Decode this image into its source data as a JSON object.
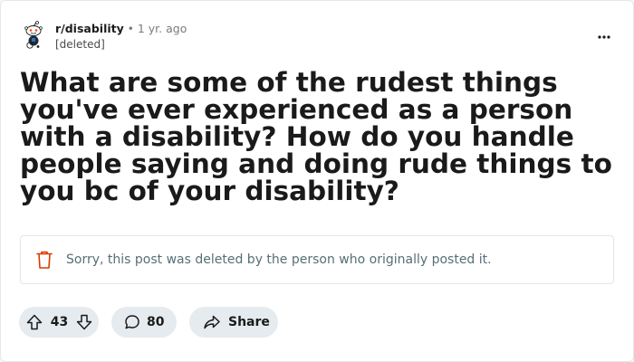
{
  "post": {
    "subreddit": "r/disability",
    "separator": "•",
    "time": "1 yr. ago",
    "author": "[deleted]",
    "title": "What are some of the rudest things you've ever experienced as a person with a disability? How do you handle people saying and doing rude things to you bc of your disability?",
    "deleted_notice": "Sorry, this post was deleted by the person who originally posted it."
  },
  "actions": {
    "vote_count": "43",
    "comment_count": "80",
    "share_label": "Share"
  },
  "icons": {
    "avatar": "reddit-snoo-avatar-icon",
    "more": "more-options-icon",
    "trash": "trash-icon",
    "upvote": "upvote-arrow-icon",
    "downvote": "downvote-arrow-icon",
    "comment": "comment-bubble-icon",
    "share": "share-arrow-icon"
  },
  "colors": {
    "trash_icon": "#d93a00",
    "pill_background": "#e5ebee",
    "deleted_text": "#576f76"
  }
}
